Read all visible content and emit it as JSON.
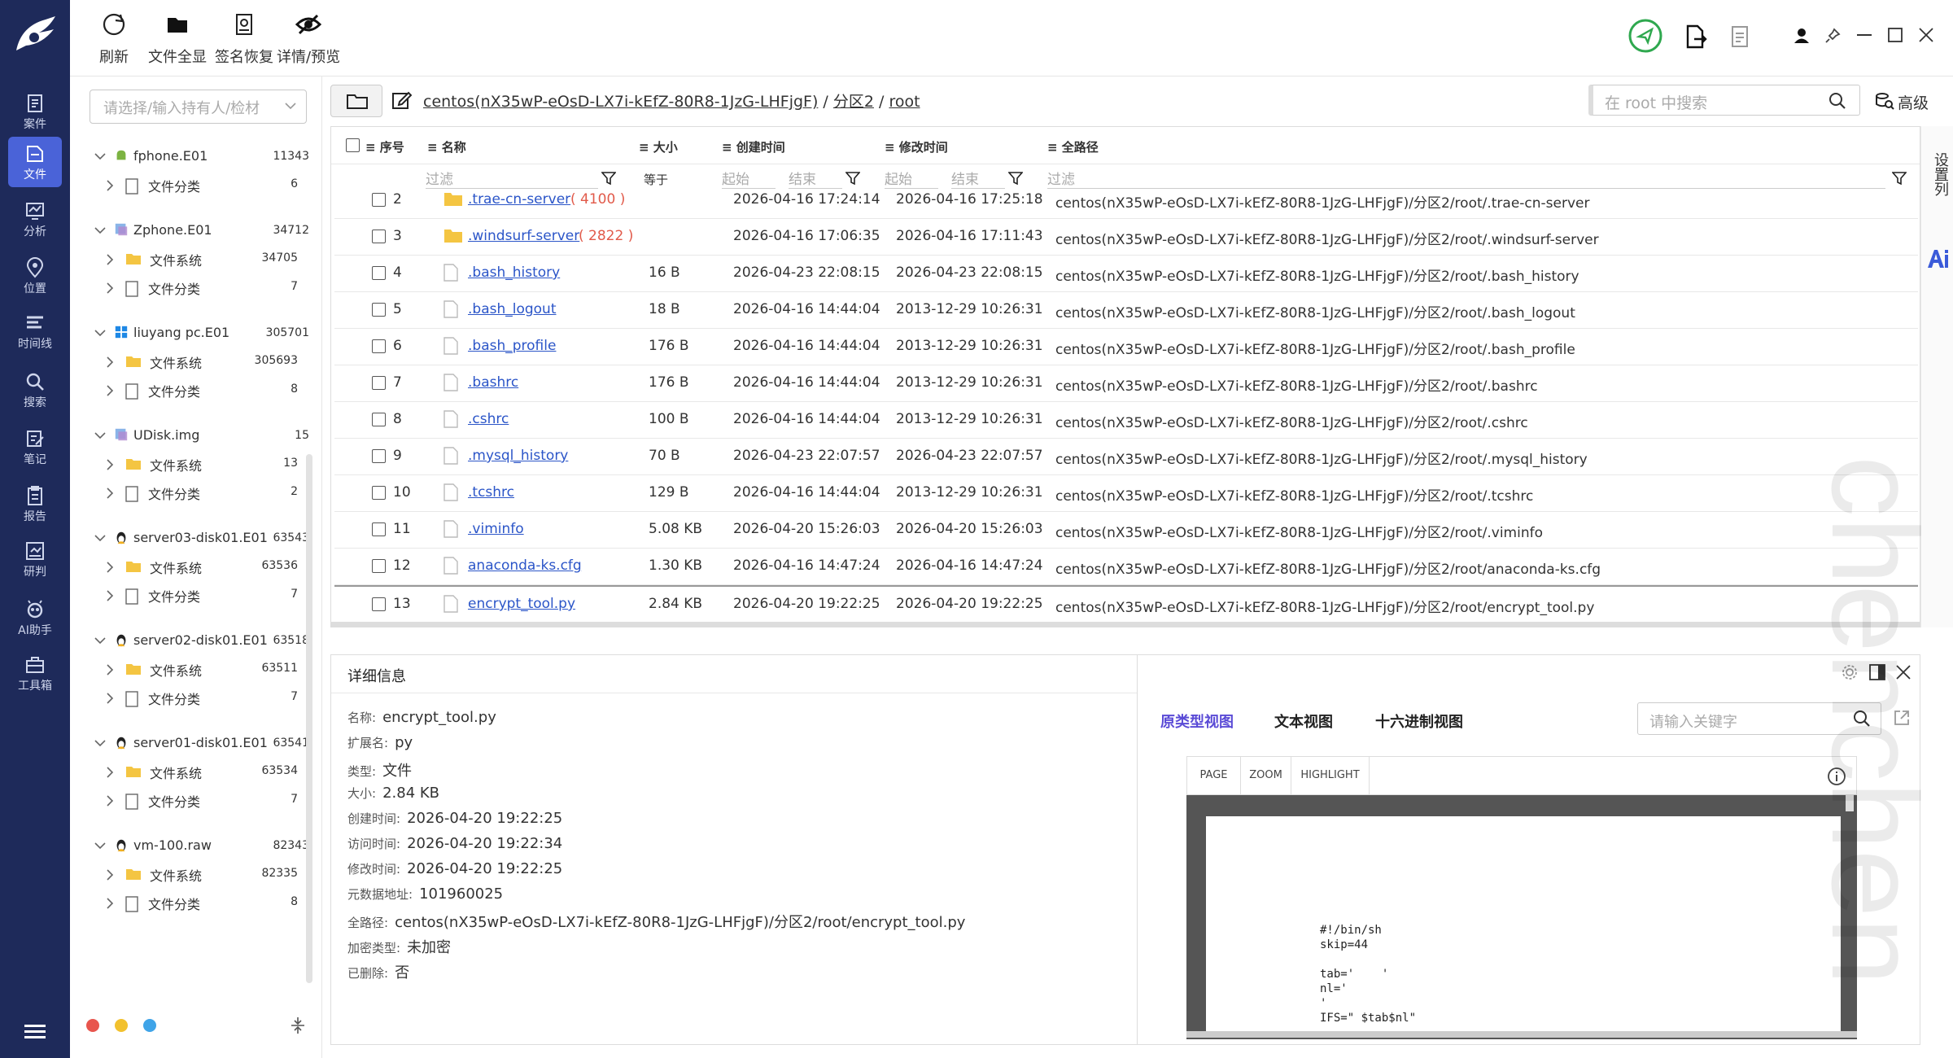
{
  "toolbar": {
    "refresh": "刷新",
    "file_all": "文件全显",
    "sign_restore": "签名恢复",
    "detail_preview": "详情/预览"
  },
  "nav": [
    {
      "label": "案件",
      "icon": "case-icon"
    },
    {
      "label": "文件",
      "icon": "file-icon"
    },
    {
      "label": "分析",
      "icon": "analysis-icon"
    },
    {
      "label": "位置",
      "icon": "location-icon"
    },
    {
      "label": "时间线",
      "icon": "timeline-icon"
    },
    {
      "label": "搜索",
      "icon": "search-icon"
    },
    {
      "label": "笔记",
      "icon": "note-icon"
    },
    {
      "label": "报告",
      "icon": "report-icon"
    },
    {
      "label": "研判",
      "icon": "judge-icon"
    },
    {
      "label": "AI助手",
      "icon": "ai-assistant-icon"
    },
    {
      "label": "工具箱",
      "icon": "toolbox-icon"
    }
  ],
  "holder_placeholder": "请选择/输入持有人/检材",
  "tree": [
    {
      "name": "fphone.E01",
      "count": "11343",
      "children": [
        {
          "name": "文件分类",
          "count": "6"
        }
      ]
    },
    {
      "name": "Zphone.E01",
      "count": "34712",
      "children": [
        {
          "name": "文件系统",
          "count": "34705"
        },
        {
          "name": "文件分类",
          "count": "7"
        }
      ]
    },
    {
      "name": "liuyang pc.E01",
      "count": "305701",
      "children": [
        {
          "name": "文件系统",
          "count": "305693"
        },
        {
          "name": "文件分类",
          "count": "8"
        }
      ]
    },
    {
      "name": "UDisk.img",
      "count": "15",
      "children": [
        {
          "name": "文件系统",
          "count": "13"
        },
        {
          "name": "文件分类",
          "count": "2"
        }
      ]
    },
    {
      "name": "server03-disk01.E01",
      "count": "63543",
      "children": [
        {
          "name": "文件系统",
          "count": "63536"
        },
        {
          "name": "文件分类",
          "count": "7"
        }
      ]
    },
    {
      "name": "server02-disk01.E01",
      "count": "63518",
      "children": [
        {
          "name": "文件系统",
          "count": "63511"
        },
        {
          "name": "文件分类",
          "count": "7"
        }
      ]
    },
    {
      "name": "server01-disk01.E01",
      "count": "63541",
      "children": [
        {
          "name": "文件系统",
          "count": "63534"
        },
        {
          "name": "文件分类",
          "count": "7"
        }
      ]
    },
    {
      "name": "vm-100.raw",
      "count": "82343",
      "children": [
        {
          "name": "文件系统",
          "count": "82335"
        },
        {
          "name": "文件分类",
          "count": "8"
        }
      ]
    }
  ],
  "path": {
    "device": "centos(nX35wP-eOsD-LX7i-kEfZ-80R8-1JzG-LHFjgF)",
    "sep1": "/",
    "part": "分区2",
    "sep2": "/",
    "dir": "root"
  },
  "search_placeholder": "在 root 中搜索",
  "advanced": "高级",
  "columns": {
    "seq": "序号",
    "name": "名称",
    "size": "大小",
    "created": "创建时间",
    "modified": "修改时间",
    "fullpath": "全路径"
  },
  "filters": {
    "name": "过滤",
    "size": "等于",
    "start": "起始",
    "end": "结束",
    "start2": "起始",
    "end2": "结束",
    "path": "过滤"
  },
  "side_settings": "设置列",
  "rows": [
    {
      "seq": "2",
      "name": ".trae-cn-server",
      "count": "( 4100 )",
      "size": "",
      "created": "2026-04-16 17:24:14",
      "modified": "2026-04-16 17:25:18",
      "path": "centos(nX35wP-eOsD-LX7i-kEfZ-80R8-1JzG-LHFjgF)/分区2/root/.trae-cn-server",
      "folder": true
    },
    {
      "seq": "3",
      "name": ".windsurf-server",
      "count": "( 2822 )",
      "size": "",
      "created": "2026-04-16 17:06:35",
      "modified": "2026-04-16 17:11:43",
      "path": "centos(nX35wP-eOsD-LX7i-kEfZ-80R8-1JzG-LHFjgF)/分区2/root/.windsurf-server",
      "folder": true
    },
    {
      "seq": "4",
      "name": ".bash_history",
      "count": "",
      "size": "16 B",
      "created": "2026-04-23 22:08:15",
      "modified": "2026-04-23 22:08:15",
      "path": "centos(nX35wP-eOsD-LX7i-kEfZ-80R8-1JzG-LHFjgF)/分区2/root/.bash_history",
      "folder": false
    },
    {
      "seq": "5",
      "name": ".bash_logout",
      "count": "",
      "size": "18 B",
      "created": "2026-04-16 14:44:04",
      "modified": "2013-12-29 10:26:31",
      "path": "centos(nX35wP-eOsD-LX7i-kEfZ-80R8-1JzG-LHFjgF)/分区2/root/.bash_logout",
      "folder": false
    },
    {
      "seq": "6",
      "name": ".bash_profile",
      "count": "",
      "size": "176 B",
      "created": "2026-04-16 14:44:04",
      "modified": "2013-12-29 10:26:31",
      "path": "centos(nX35wP-eOsD-LX7i-kEfZ-80R8-1JzG-LHFjgF)/分区2/root/.bash_profile",
      "folder": false
    },
    {
      "seq": "7",
      "name": ".bashrc",
      "count": "",
      "size": "176 B",
      "created": "2026-04-16 14:44:04",
      "modified": "2013-12-29 10:26:31",
      "path": "centos(nX35wP-eOsD-LX7i-kEfZ-80R8-1JzG-LHFjgF)/分区2/root/.bashrc",
      "folder": false
    },
    {
      "seq": "8",
      "name": ".cshrc",
      "count": "",
      "size": "100 B",
      "created": "2026-04-16 14:44:04",
      "modified": "2013-12-29 10:26:31",
      "path": "centos(nX35wP-eOsD-LX7i-kEfZ-80R8-1JzG-LHFjgF)/分区2/root/.cshrc",
      "folder": false
    },
    {
      "seq": "9",
      "name": ".mysql_history",
      "count": "",
      "size": "70 B",
      "created": "2026-04-23 22:07:57",
      "modified": "2026-04-23 22:07:57",
      "path": "centos(nX35wP-eOsD-LX7i-kEfZ-80R8-1JzG-LHFjgF)/分区2/root/.mysql_history",
      "folder": false
    },
    {
      "seq": "10",
      "name": ".tcshrc",
      "count": "",
      "size": "129 B",
      "created": "2026-04-16 14:44:04",
      "modified": "2013-12-29 10:26:31",
      "path": "centos(nX35wP-eOsD-LX7i-kEfZ-80R8-1JzG-LHFjgF)/分区2/root/.tcshrc",
      "folder": false
    },
    {
      "seq": "11",
      "name": ".viminfo",
      "count": "",
      "size": "5.08 KB",
      "created": "2026-04-20 15:26:03",
      "modified": "2026-04-20 15:26:03",
      "path": "centos(nX35wP-eOsD-LX7i-kEfZ-80R8-1JzG-LHFjgF)/分区2/root/.viminfo",
      "folder": false
    },
    {
      "seq": "12",
      "name": "anaconda-ks.cfg",
      "count": "",
      "size": "1.30 KB",
      "created": "2026-04-16 14:47:24",
      "modified": "2026-04-16 14:47:24",
      "path": "centos(nX35wP-eOsD-LX7i-kEfZ-80R8-1JzG-LHFjgF)/分区2/root/anaconda-ks.cfg",
      "folder": false
    },
    {
      "seq": "13",
      "name": "encrypt_tool.py",
      "count": "",
      "size": "2.84 KB",
      "created": "2026-04-20 19:22:25",
      "modified": "2026-04-20 19:22:25",
      "path": "centos(nX35wP-eOsD-LX7i-kEfZ-80R8-1JzG-LHFjgF)/分区2/root/encrypt_tool.py",
      "folder": false
    }
  ],
  "details": {
    "title": "详细信息",
    "fields": [
      {
        "label": "名称:",
        "value": "encrypt_tool.py"
      },
      {
        "label": "扩展名:",
        "value": "py"
      },
      {
        "label": "类型:",
        "value": "文件"
      },
      {
        "label": "大小:",
        "value": "2.84 KB"
      },
      {
        "label": "创建时间:",
        "value": "2026-04-20 19:22:25"
      },
      {
        "label": "访问时间:",
        "value": "2026-04-20 19:22:34"
      },
      {
        "label": "修改时间:",
        "value": "2026-04-20 19:22:25"
      },
      {
        "label": "元数据地址:",
        "value": "101960025"
      },
      {
        "label": "全路径:",
        "value": "centos(nX35wP-eOsD-LX7i-kEfZ-80R8-1JzG-LHFjgF)/分区2/root/encrypt_tool.py"
      },
      {
        "label": "加密类型:",
        "value": "未加密"
      },
      {
        "label": "已删除:",
        "value": "否"
      }
    ]
  },
  "preview": {
    "tabs": [
      "原类型视图",
      "文本视图",
      "十六进制视图"
    ],
    "keyword_placeholder": "请输入关键字",
    "viewer_buttons": [
      "PAGE",
      "ZOOM",
      "HIGHLIGHT"
    ],
    "code": [
      "#!/bin/sh",
      "skip=44",
      "",
      "tab='    '",
      "nl='",
      "'",
      "IFS=\" $tab$nl\""
    ]
  },
  "watermark": "chenchen",
  "colors": {
    "nav_bg": "#1e2a5a",
    "nav_active": "#4a63d8",
    "link": "#2b55c8",
    "accent_tab": "#5a4bd6"
  }
}
